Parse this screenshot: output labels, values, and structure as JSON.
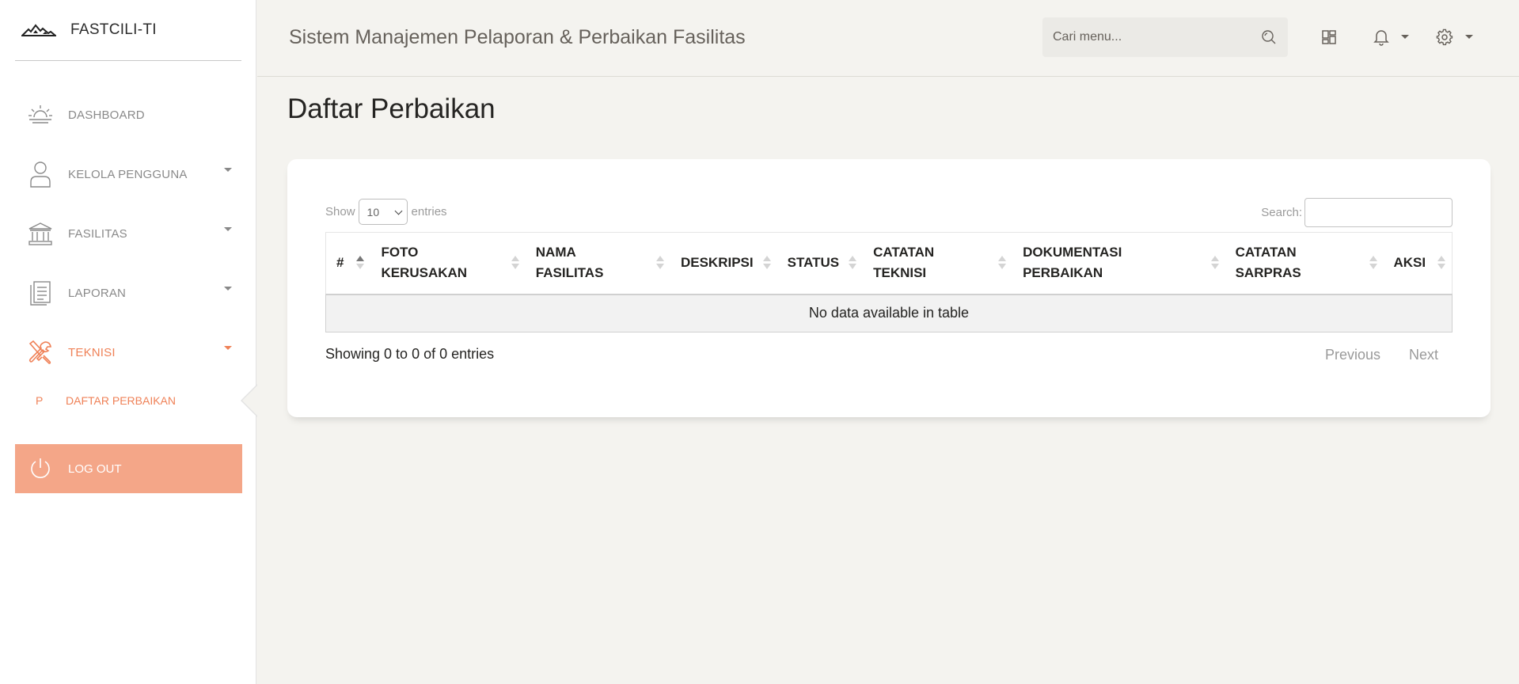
{
  "brand": {
    "app_name": "FASTCILI-TI",
    "logo": "mountain-logo-icon"
  },
  "sidebar": {
    "items": [
      {
        "label": "DASHBOARD",
        "icon": "sunrise-icon"
      },
      {
        "label": "KELOLA PENGGUNA",
        "icon": "user-icon"
      },
      {
        "label": "FASILITAS",
        "icon": "bank-icon"
      },
      {
        "label": "LAPORAN",
        "icon": "document-icon"
      },
      {
        "label": "TEKNISI",
        "icon": "tools-icon"
      }
    ],
    "sub_item": {
      "abbr": "P",
      "label": "DAFTAR PERBAIKAN"
    },
    "logout": {
      "label": "LOG OUT",
      "icon": "power-icon"
    }
  },
  "navbar": {
    "title": "Sistem Manajemen Pelaporan & Perbaikan Fasilitas",
    "search_placeholder": "Cari menu...",
    "icons": [
      "search-icon",
      "layout-icon",
      "bell-icon",
      "gear-icon"
    ]
  },
  "page": {
    "title": "Daftar Perbaikan"
  },
  "table": {
    "show_label": "Show",
    "entries_value": "10",
    "entries_label": "entries",
    "search_label": "Search:",
    "columns": [
      {
        "label": "#",
        "lines": [
          "#"
        ]
      },
      {
        "label": "FOTO KERUSAKAN",
        "lines": [
          "FOTO",
          "KERUSAKAN"
        ]
      },
      {
        "label": "NAMA FASILITAS",
        "lines": [
          "NAMA",
          "FASILITAS"
        ]
      },
      {
        "label": "DESKRIPSI",
        "lines": [
          "DESKRIPSI"
        ]
      },
      {
        "label": "STATUS",
        "lines": [
          "STATUS"
        ]
      },
      {
        "label": "CATATAN TEKNISI",
        "lines": [
          "CATATAN",
          "TEKNISI"
        ]
      },
      {
        "label": "DOKUMENTASI PERBAIKAN",
        "lines": [
          "DOKUMENTASI",
          "PERBAIKAN"
        ]
      },
      {
        "label": "CATATAN SARPRAS",
        "lines": [
          "CATATAN",
          "SARPRAS"
        ]
      },
      {
        "label": "AKSI",
        "lines": [
          "AKSI"
        ]
      }
    ],
    "empty_message": "No data available in table",
    "info": "Showing 0 to 0 of 0 entries",
    "previous": "Previous",
    "next": "Next"
  },
  "colors": {
    "accent": "#ef8157",
    "logout_bg": "#f4a688",
    "background": "#f4f3ef"
  }
}
